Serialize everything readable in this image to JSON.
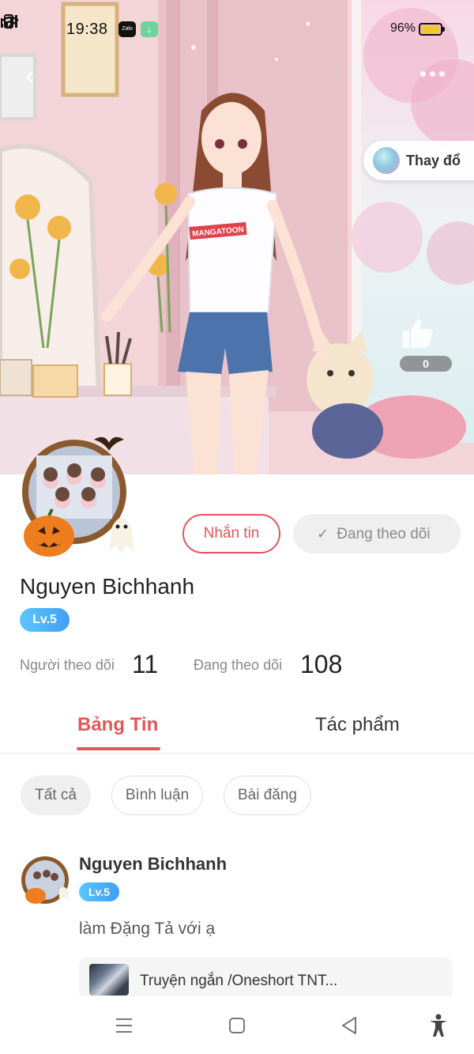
{
  "status_bar": {
    "time": "19:38",
    "notification_icons": [
      "zalo-icon",
      "download-icon"
    ],
    "zalo_label": "Zalo",
    "battery_percent": "96%",
    "battery_level": 0.96
  },
  "hero": {
    "change_button_label": "Thay đổ",
    "like_count": "0",
    "shirt_text": "MANGATOON"
  },
  "profile": {
    "message_button": "Nhắn tin",
    "following_button": "Đang theo dõi",
    "name": "Nguyen Bichhanh",
    "level": "Lv.5",
    "followers_label": "Người theo dõi",
    "followers_count": "11",
    "following_label": "Đang theo dõi",
    "following_count": "108"
  },
  "tabs": [
    {
      "label": "Bảng Tin",
      "active": true
    },
    {
      "label": "Tác phẩm",
      "active": false
    }
  ],
  "filters": [
    {
      "label": "Tất cả",
      "active": true
    },
    {
      "label": "Bình luận",
      "active": false
    },
    {
      "label": "Bài đăng",
      "active": false
    }
  ],
  "post": {
    "author": "Nguyen Bichhanh",
    "level": "Lv.5",
    "text": "làm Đặng Tả với ạ",
    "card_title": "Truyện ngắn /Oneshort TNT..."
  },
  "colors": {
    "accent": "#e2555a",
    "level_badge": "#4aafff",
    "chip_active_bg": "#efefef"
  },
  "nav_icons": [
    "menu-icon",
    "home-square-icon",
    "back-triangle-icon",
    "accessibility-icon"
  ]
}
